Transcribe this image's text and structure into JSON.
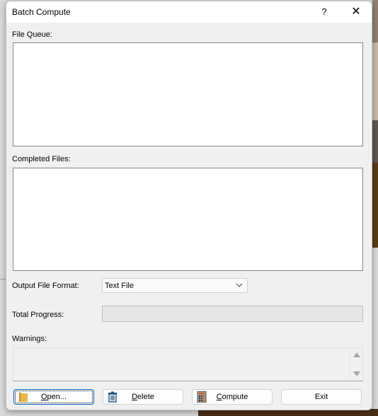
{
  "window": {
    "title": "Batch Compute",
    "help_label": "?",
    "close_label": "✕"
  },
  "file_queue": {
    "label": "File Queue:",
    "items": []
  },
  "completed_files": {
    "label": "Completed Files:",
    "items": []
  },
  "output_format": {
    "label": "Output File Format:",
    "selected": "Text File"
  },
  "total_progress": {
    "label": "Total Progress:",
    "value_percent": 0
  },
  "warnings": {
    "label": "Warnings:",
    "text": ""
  },
  "buttons": {
    "open": {
      "mnemonic": "O",
      "rest": "pen...",
      "icon": "folder-icon"
    },
    "delete": {
      "mnemonic": "D",
      "rest": "elete",
      "icon": "trash-icon"
    },
    "compute": {
      "mnemonic": "C",
      "rest": "ompute",
      "icon": "calculator-icon"
    },
    "exit": {
      "label": "Exit"
    }
  },
  "colors": {
    "focus_border": "#0067c0",
    "folder": "#e8b64c",
    "trash": "#1c4f7a",
    "calculator_accent": "#e05a1c"
  }
}
